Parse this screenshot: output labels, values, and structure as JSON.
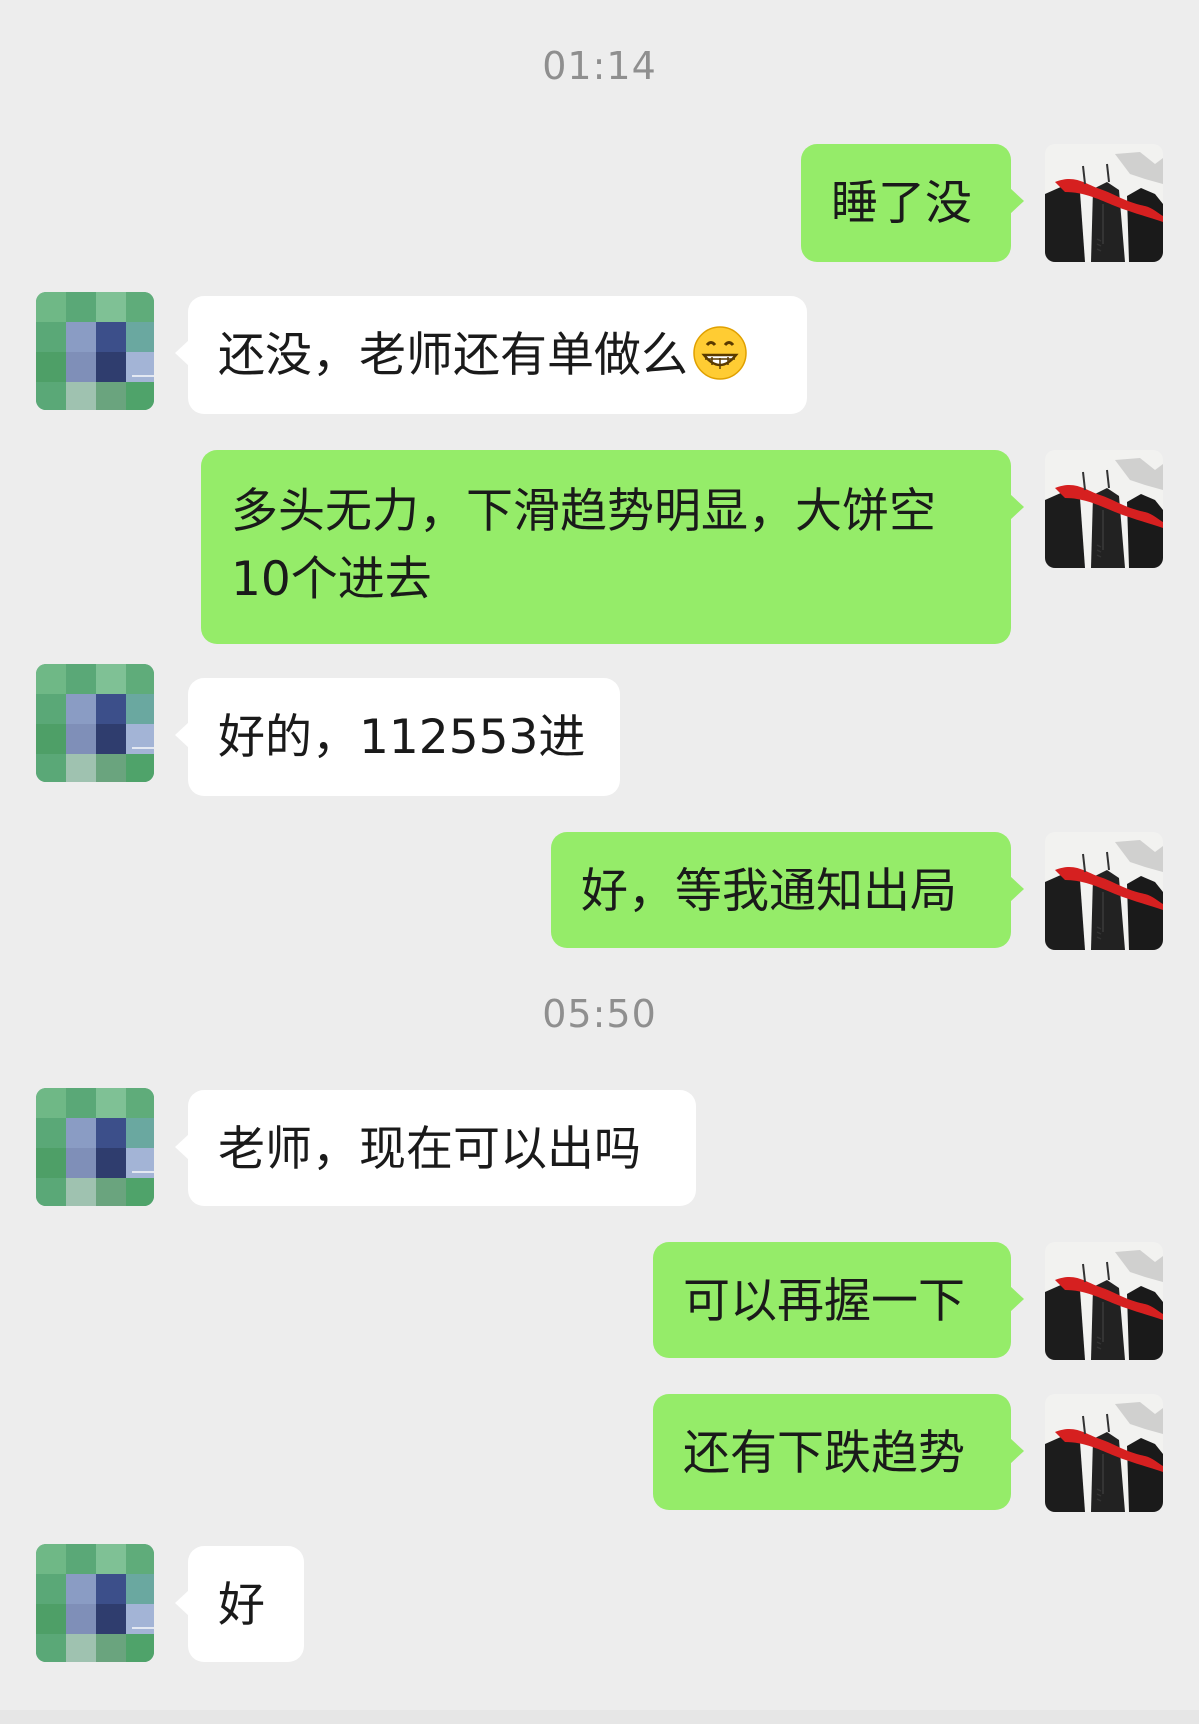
{
  "timestamps": [
    "01:14",
    "05:50"
  ],
  "messages": [
    {
      "side": "sent",
      "text": "睡了没",
      "avatar": "ink-painting-avatar"
    },
    {
      "side": "recv",
      "text": "还没，老师还有单做么",
      "emoji": "grinning-emoji",
      "avatar": "pixelated-sneaker-avatar"
    },
    {
      "side": "sent",
      "line1": "多头无力，下滑趋势明显，大饼空",
      "line2": "10个进去",
      "avatar": "ink-painting-avatar"
    },
    {
      "side": "recv",
      "text": "好的，112553进",
      "avatar": "pixelated-sneaker-avatar"
    },
    {
      "side": "sent",
      "text": "好，等我通知出局",
      "avatar": "ink-painting-avatar"
    },
    {
      "side": "recv",
      "text": "老师，现在可以出吗",
      "avatar": "pixelated-sneaker-avatar"
    },
    {
      "side": "sent",
      "text": "可以再握一下",
      "avatar": "ink-painting-avatar"
    },
    {
      "side": "sent",
      "text": "还有下跌趋势",
      "avatar": "ink-painting-avatar"
    },
    {
      "side": "recv",
      "text": "好",
      "avatar": "pixelated-sneaker-avatar"
    }
  ],
  "colors": {
    "background": "#ededed",
    "sent_bubble": "#95ec69",
    "recv_bubble": "#ffffff",
    "timestamp_text": "#8f8f8f"
  }
}
